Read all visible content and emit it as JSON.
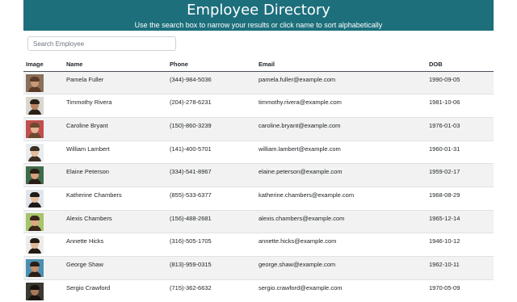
{
  "header": {
    "title": "Employee Directory",
    "subtitle": "Use the search box to narrow your results or click name to sort alphabetically"
  },
  "search": {
    "placeholder": "Search Employee",
    "value": ""
  },
  "table": {
    "columns": [
      "Image",
      "Name",
      "Phone",
      "Email",
      "DOB"
    ],
    "rows": [
      {
        "name": "Pamela Fuller",
        "phone": "(344)-984-5036",
        "email": "pamela.fuller@example.com",
        "dob": "1990-09-05",
        "bg": "#8a6f5a",
        "skin": "#c99877",
        "hair": "#5a3b28"
      },
      {
        "name": "Timmothy Rivera",
        "phone": "(204)-278-6231",
        "email": "timmothy.rivera@example.com",
        "dob": "1981-10-06",
        "bg": "#d8d8d0",
        "skin": "#b88462",
        "hair": "#2b2118"
      },
      {
        "name": "Caroline Bryant",
        "phone": "(150)-860-3239",
        "email": "caroline.bryant@example.com",
        "dob": "1976-01-03",
        "bg": "#c0504d",
        "skin": "#e2b595",
        "hair": "#6b4a2e"
      },
      {
        "name": "William Lambert",
        "phone": "(141)-400-5701",
        "email": "william.lambert@example.com",
        "dob": "1960-01-31",
        "bg": "#e8ecef",
        "skin": "#e4bb9c",
        "hair": "#3d2e22"
      },
      {
        "name": "Elaine Peterson",
        "phone": "(334)-541-8967",
        "email": "elaine.peterson@example.com",
        "dob": "1959-02-17",
        "bg": "#3f6b4a",
        "skin": "#d7a07c",
        "hair": "#2a1c14"
      },
      {
        "name": "Katherine Chambers",
        "phone": "(855)-533-6377",
        "email": "katherine.chambers@example.com",
        "dob": "1968-08-29",
        "bg": "#dfe5ea",
        "skin": "#e6bfa0",
        "hair": "#1e1a18"
      },
      {
        "name": "Alexis Chambers",
        "phone": "(156)-488-2681",
        "email": "alexis.chambers@example.com",
        "dob": "1965-12-14",
        "bg": "#a6c46b",
        "skin": "#dba883",
        "hair": "#3a261a"
      },
      {
        "name": "Annette Hicks",
        "phone": "(316)-505-1705",
        "email": "annette.hicks@example.com",
        "dob": "1946-10-12",
        "bg": "#ececec",
        "skin": "#e3b898",
        "hair": "#241a14"
      },
      {
        "name": "George Shaw",
        "phone": "(813)-959-0315",
        "email": "george.shaw@example.com",
        "dob": "1962-10-11",
        "bg": "#4d8fb0",
        "skin": "#c48e6a",
        "hair": "#2a1e16"
      },
      {
        "name": "Sergio Crawford",
        "phone": "(715)-362-6632",
        "email": "sergio.crawford@example.com",
        "dob": "1970-05-09",
        "bg": "#3a3a32",
        "skin": "#a8785a",
        "hair": "#1a1410"
      }
    ]
  },
  "colors": {
    "banner": "#1d6f7c",
    "stripe": "#f2f2f2"
  }
}
